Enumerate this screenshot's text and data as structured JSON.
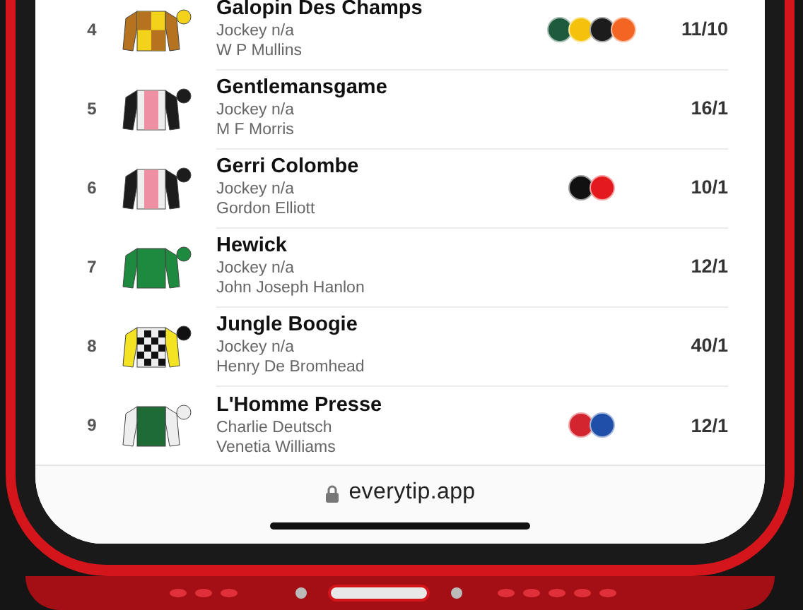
{
  "runners": [
    {
      "number": "4",
      "name": "Galopin Des Champs",
      "jockey": "Jockey n/a",
      "trainer": "W P Mullins",
      "silk": [
        {
          "kind": "body",
          "color": "#f2d21b"
        },
        {
          "kind": "quarters",
          "color": "#b5731f"
        },
        {
          "kind": "sleeves",
          "color": "#b5731f"
        },
        {
          "kind": "cap",
          "color": "#f2d21b"
        }
      ],
      "bookmakers": [
        {
          "color": "#1e5a3c"
        },
        {
          "color": "#f4c20d"
        },
        {
          "color": "#1c1c1c"
        },
        {
          "color": "#f26522"
        }
      ],
      "odds": "11/10"
    },
    {
      "number": "5",
      "name": "Gentlemansgame",
      "jockey": "Jockey n/a",
      "trainer": "M F Morris",
      "silk": [
        {
          "kind": "body",
          "color": "#eeeeee"
        },
        {
          "kind": "stripe",
          "color": "#ef8fa3"
        },
        {
          "kind": "sleeves",
          "color": "#1c1c1c"
        },
        {
          "kind": "cap",
          "color": "#1c1c1c"
        }
      ],
      "odds": "16/1"
    },
    {
      "number": "6",
      "name": "Gerri Colombe",
      "jockey": "Jockey n/a",
      "trainer": "Gordon Elliott",
      "silk": [
        {
          "kind": "body",
          "color": "#eeeeee"
        },
        {
          "kind": "stripe",
          "color": "#ef8fa3"
        },
        {
          "kind": "sleeves",
          "color": "#1c1c1c"
        },
        {
          "kind": "cap",
          "color": "#1c1c1c"
        }
      ],
      "bookmakers": [
        {
          "color": "#111111"
        },
        {
          "color": "#e3191e"
        }
      ],
      "odds": "10/1"
    },
    {
      "number": "7",
      "name": "Hewick",
      "jockey": "Jockey n/a",
      "trainer": "John Joseph Hanlon",
      "silk": [
        {
          "kind": "body",
          "color": "#1d8a3f"
        },
        {
          "kind": "sleeves",
          "color": "#1d8a3f"
        },
        {
          "kind": "cap",
          "color": "#1d8a3f"
        }
      ],
      "odds": "12/1"
    },
    {
      "number": "8",
      "name": "Jungle Boogie",
      "jockey": "Jockey n/a",
      "trainer": "Henry De Bromhead",
      "silk": [
        {
          "kind": "body",
          "color": "#eeeeee"
        },
        {
          "kind": "checks",
          "color": "#111111"
        },
        {
          "kind": "sleeves",
          "color": "#f3e323"
        },
        {
          "kind": "cap",
          "color": "#111111"
        }
      ],
      "odds": "40/1"
    },
    {
      "number": "9",
      "name": "L'Homme Presse",
      "jockey": "Charlie Deutsch",
      "trainer": "Venetia Williams",
      "silk": [
        {
          "kind": "body",
          "color": "#1f6b35"
        },
        {
          "kind": "sleeves",
          "color": "#eeeeee"
        },
        {
          "kind": "cap",
          "color": "#eeeeee"
        }
      ],
      "bookmakers": [
        {
          "color": "#d3252f"
        },
        {
          "color": "#1f4fa8"
        }
      ],
      "odds": "12/1"
    }
  ],
  "address_bar": {
    "url": "everytip.app"
  }
}
